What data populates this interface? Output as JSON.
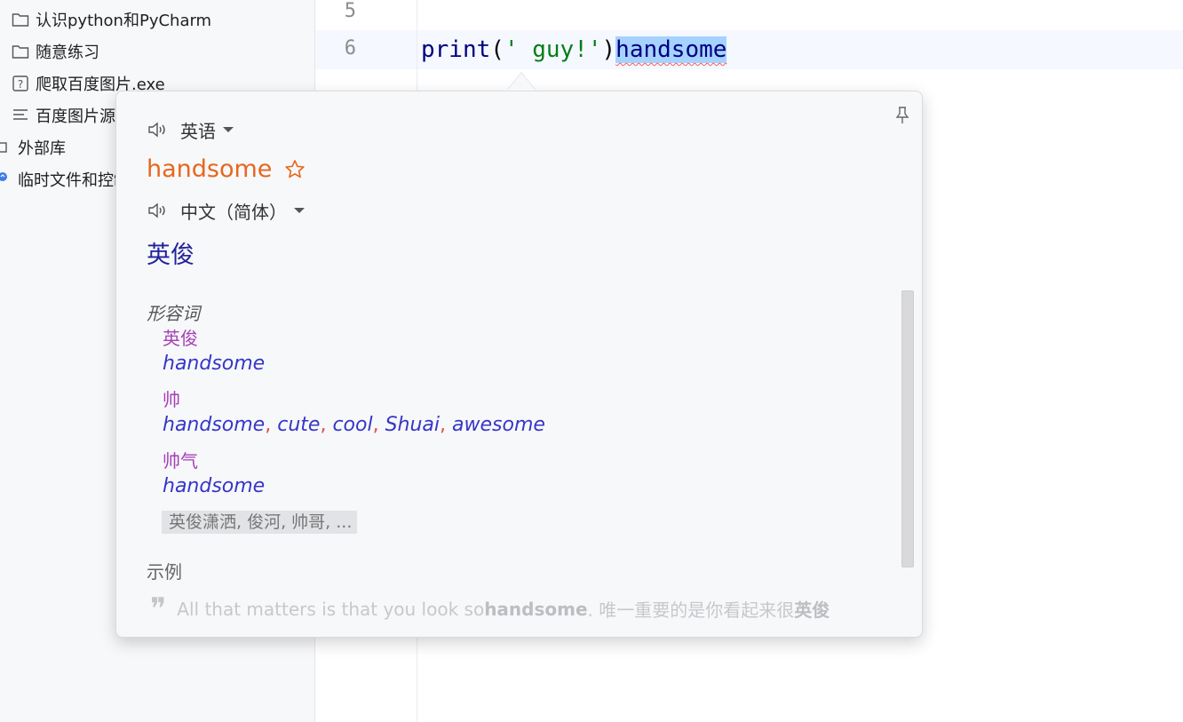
{
  "project_tree": {
    "items": [
      {
        "label": "认识python和PyCharm",
        "icon": "folder-icon"
      },
      {
        "label": "随意练习",
        "icon": "folder-icon"
      },
      {
        "label": "爬取百度图片.exe",
        "icon": "unknown-file-icon"
      },
      {
        "label": "百度图片源",
        "icon": "text-file-icon"
      },
      {
        "label": "外部库",
        "icon": "library-icon"
      },
      {
        "label": "临时文件和控制",
        "icon": "scratch-icon"
      }
    ]
  },
  "editor": {
    "line_numbers": [
      "5",
      "6"
    ],
    "code": {
      "fn": "print",
      "open": "(",
      "str": "' guy!'",
      "close": ")",
      "selected": "handsome"
    }
  },
  "translator": {
    "source_lang": "英语",
    "word": "handsome",
    "target_lang": "中文（简体）",
    "translation": "英俊",
    "part_of_speech": "形容词",
    "entries": [
      {
        "zh": "英俊",
        "en": [
          "handsome"
        ]
      },
      {
        "zh": "帅",
        "en": [
          "handsome",
          "cute",
          "cool",
          "Shuai",
          "awesome"
        ]
      },
      {
        "zh": "帅气",
        "en": [
          "handsome"
        ]
      }
    ],
    "entry_separator": ",",
    "more": "英俊潇洒, 俊河, 帅哥, ...",
    "examples_title": "示例",
    "example": {
      "quote_mark": "❞",
      "before": "All that matters is that you look so ",
      "bold": "handsome",
      "after": " . 唯一重要的是你看起来很",
      "bold_zh": "英俊"
    },
    "colors": {
      "word": "#e8661e",
      "translation": "#22229c",
      "entry_zh": "#a63fb5",
      "entry_en": "#3636c8",
      "separator": "#e05050"
    }
  }
}
